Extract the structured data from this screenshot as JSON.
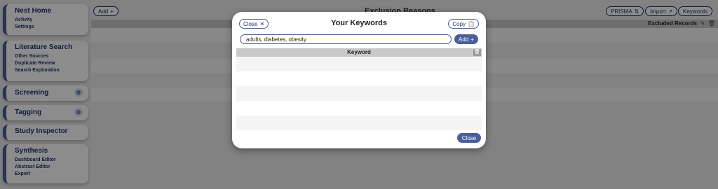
{
  "sidebar": {
    "sections": [
      {
        "title": "Nest Home",
        "links": [
          "Activity",
          "Settings"
        ],
        "gear": false
      },
      {
        "title": "Literature Search",
        "links": [
          "Other Sources",
          "Duplicate Review",
          "Search Exploration"
        ],
        "gear": false
      },
      {
        "title": "Screening",
        "links": [],
        "gear": true
      },
      {
        "title": "Tagging",
        "links": [],
        "gear": true
      },
      {
        "title": "Study Inspector",
        "links": [],
        "gear": false
      },
      {
        "title": "Synthesis",
        "links": [
          "Dashboard Editor",
          "Abstract Editor",
          "Export"
        ],
        "gear": false
      }
    ]
  },
  "background": {
    "add_label": "Add",
    "title": "Exclusion Reasons",
    "prisma_label": "PRISMA",
    "import_label": "Import",
    "keywords_label": "Keywords",
    "excluded_records_header": "Excluded Records"
  },
  "modal": {
    "close_top_label": "Close",
    "title": "Your Keywords",
    "copy_label": "Copy",
    "input_value": "adults, diabetes, obesity",
    "add_label": "Add",
    "column_header": "Keyword",
    "rows": [
      "",
      "",
      "",
      "",
      ""
    ],
    "close_bottom_label": "Close"
  },
  "colors": {
    "accent": "#4a5f9a",
    "nav_text": "#23306e"
  }
}
